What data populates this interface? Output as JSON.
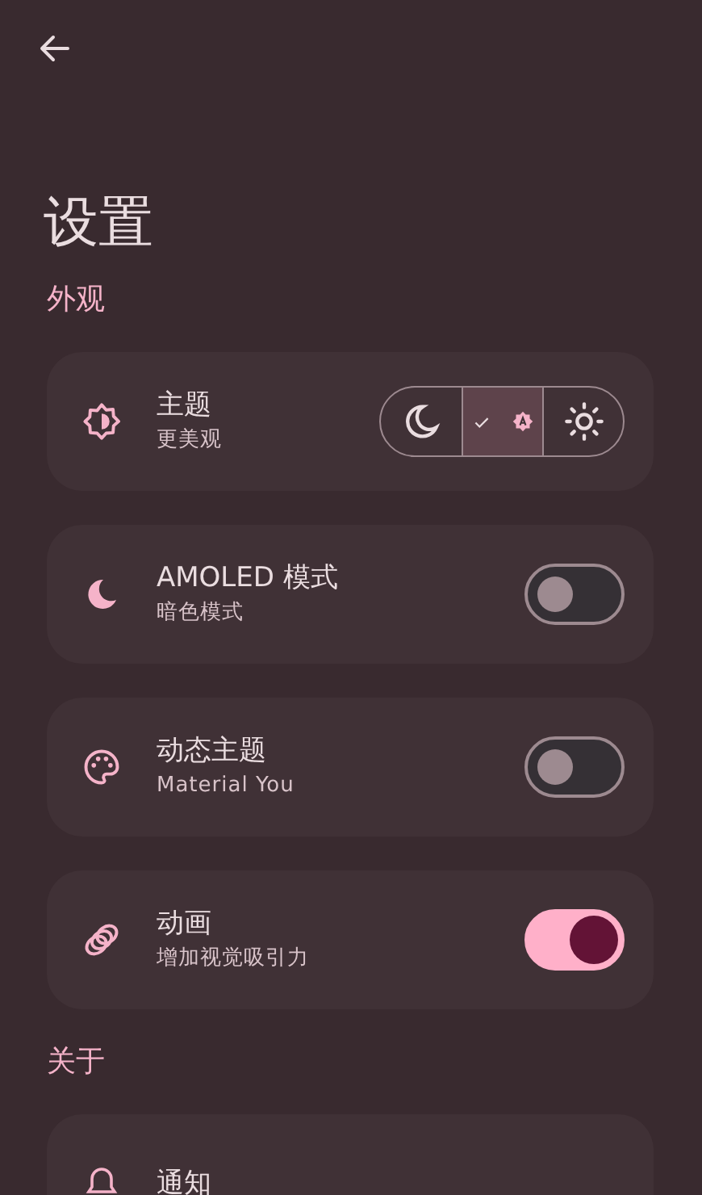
{
  "title": "设置",
  "sections": [
    {
      "title": "外观",
      "items": [
        {
          "kind": "segmented",
          "title": "主题",
          "subtitle": "更美观",
          "options": [
            {
              "kind": "dark",
              "selected": false
            },
            {
              "kind": "auto",
              "selected": true
            },
            {
              "kind": "light",
              "selected": false
            }
          ]
        },
        {
          "kind": "switch",
          "title": "AMOLED 模式",
          "subtitle": "暗色模式",
          "on": false
        },
        {
          "kind": "switch",
          "title": "动态主题",
          "subtitle": "Material You",
          "on": false
        },
        {
          "kind": "switch",
          "title": "动画",
          "subtitle": "增加视觉吸引力",
          "on": true
        }
      ]
    },
    {
      "title": "关于",
      "items": [
        {
          "kind": "plain",
          "title": "通知"
        }
      ]
    }
  ]
}
